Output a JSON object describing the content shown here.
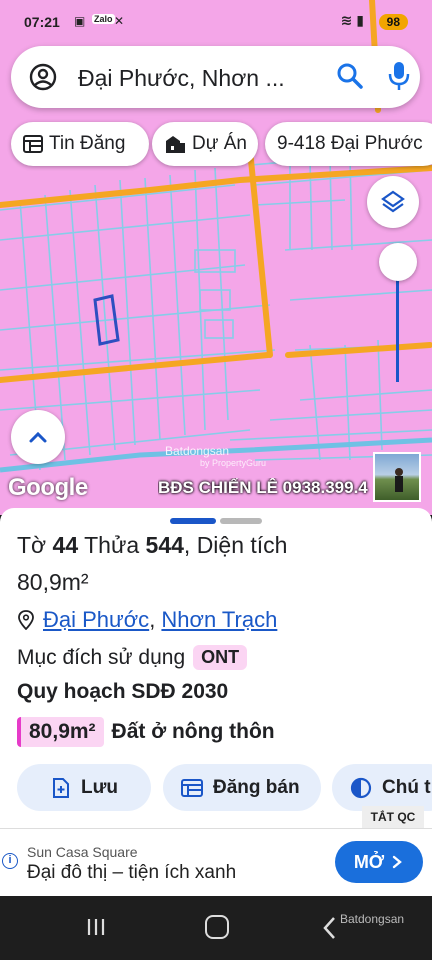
{
  "status_bar": {
    "time": "07:21",
    "notif_icons": [
      "screenshot-icon",
      "zalo-icon",
      "mute-icon"
    ],
    "zalo_label": "Zalo",
    "battery": "98"
  },
  "search": {
    "query": "Đại Phước, Nhơn ..."
  },
  "chips": [
    {
      "label": "Tin Đăng",
      "icon": "list-icon"
    },
    {
      "label": "Dự Án",
      "icon": "buildings-icon"
    },
    {
      "label": "9-418 Đại Phước",
      "icon": ""
    }
  ],
  "map": {
    "attribution": "Google",
    "watermark": "Batdongsan",
    "watermark_sub": "by PropertyGuru",
    "agent_label": "BĐS CHIẾN LÊ 0938.399.4",
    "colors": {
      "land": "#f4a6e8",
      "parcel_line": "#7ec8e3",
      "road": "#f5a623",
      "highlight": "#2d4fc0"
    }
  },
  "sheet": {
    "to_label": "Tờ",
    "to_value": "44",
    "thua_label": "Thửa",
    "thua_value": "544",
    "dientich_label": "Diện tích",
    "area": "80,9m²",
    "ward": "Đại Phước",
    "district": "Nhơn Trạch",
    "purpose_label": "Mục đích sử dụng",
    "purpose_code": "ONT",
    "plan_label": "Quy hoạch SDĐ 2030",
    "plan_area": "80,9m²",
    "plan_type": "Đất ở nông thôn"
  },
  "actions": [
    {
      "label": "Lưu",
      "icon": "add-file-icon"
    },
    {
      "label": "Đăng bán",
      "icon": "listing-icon"
    },
    {
      "label": "Chú t",
      "icon": "half-circle-icon"
    }
  ],
  "ad": {
    "close_label": "TẮT QC",
    "brand": "Sun Casa Square",
    "text": "Đại đô thị – tiện ích xanh",
    "cta": "MỞ"
  },
  "nav": {
    "watermark": "Batdongsan"
  }
}
